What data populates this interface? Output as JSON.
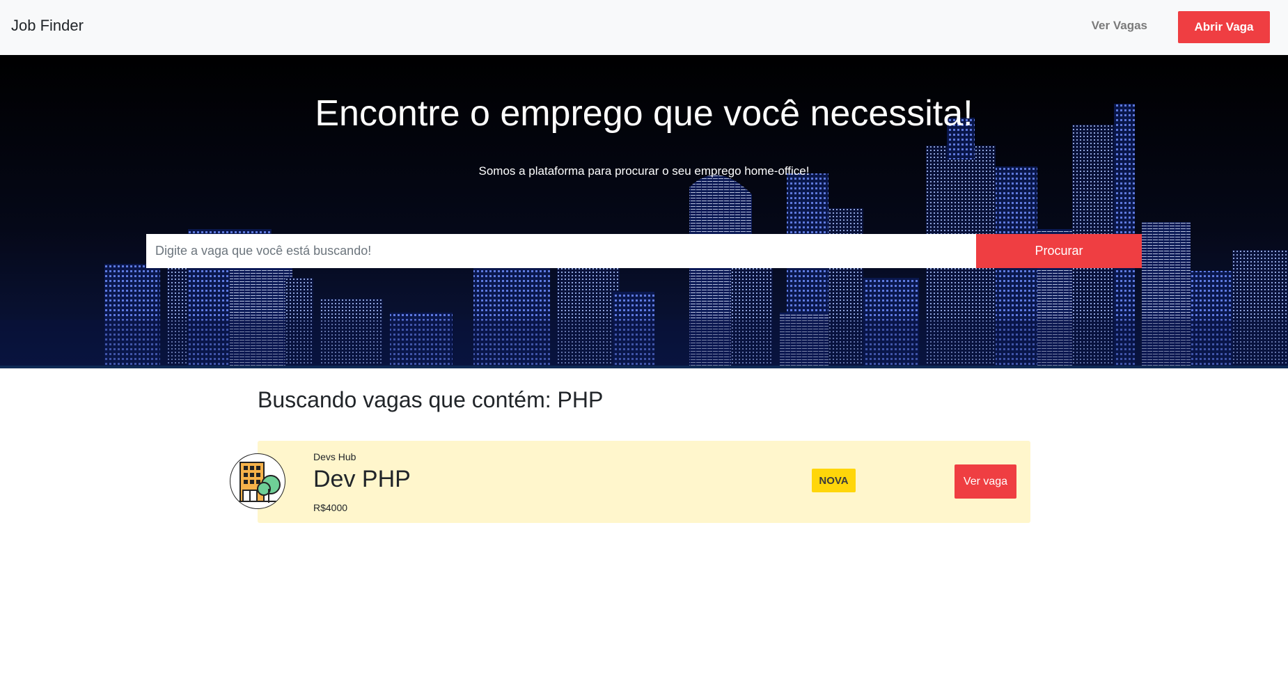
{
  "navbar": {
    "brand": "Job Finder",
    "link_label": "Ver Vagas",
    "cta_label": "Abrir Vaga"
  },
  "hero": {
    "title": "Encontre o emprego que você necessita!",
    "subtitle": "Somos a plataforma para procurar o seu emprego home-office!",
    "search_placeholder": "Digite a vaga que você está buscando!",
    "search_value": "",
    "search_button": "Procurar"
  },
  "results": {
    "title": "Buscando vagas que contém: PHP",
    "jobs": [
      {
        "company": "Devs Hub",
        "title": "Dev PHP",
        "salary": "R$4000",
        "badge": "NOVA",
        "button_label": "Ver vaga",
        "avatar_icon": "company-building-icon"
      }
    ]
  },
  "colors": {
    "accent": "#ef3e42",
    "navbar_bg": "#f8f9fa",
    "card_bg": "#fff6cc",
    "badge_bg": "#ffd60a",
    "hero_bg": "#03040c"
  }
}
